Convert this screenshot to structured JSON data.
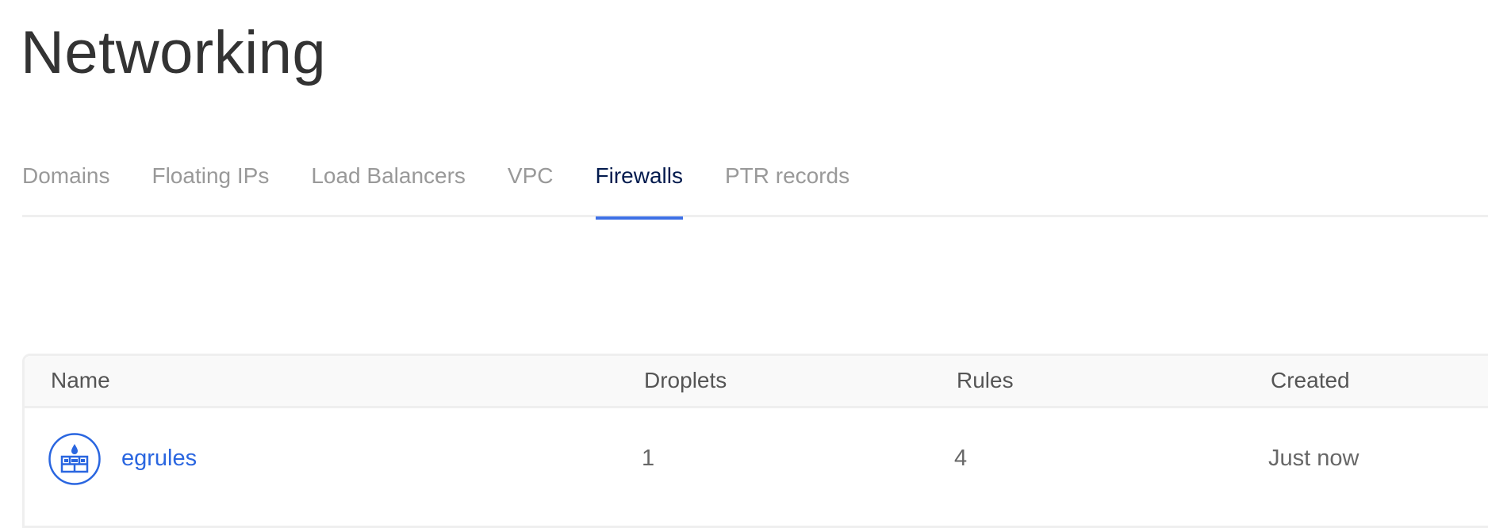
{
  "page_title": "Networking",
  "tabs": [
    {
      "label": "Domains",
      "active": false
    },
    {
      "label": "Floating IPs",
      "active": false
    },
    {
      "label": "Load Balancers",
      "active": false
    },
    {
      "label": "VPC",
      "active": false
    },
    {
      "label": "Firewalls",
      "active": true
    },
    {
      "label": "PTR records",
      "active": false
    }
  ],
  "table": {
    "columns": [
      "Name",
      "Droplets",
      "Rules",
      "Created"
    ],
    "rows": [
      {
        "icon": "firewall-icon",
        "name": "egrules",
        "droplets": "1",
        "rules": "4",
        "created": "Just now"
      }
    ]
  },
  "colors": {
    "accent": "#3d70e6",
    "link": "#2a66e0",
    "active_tab": "#031b4e",
    "inactive_tab": "#999999"
  }
}
